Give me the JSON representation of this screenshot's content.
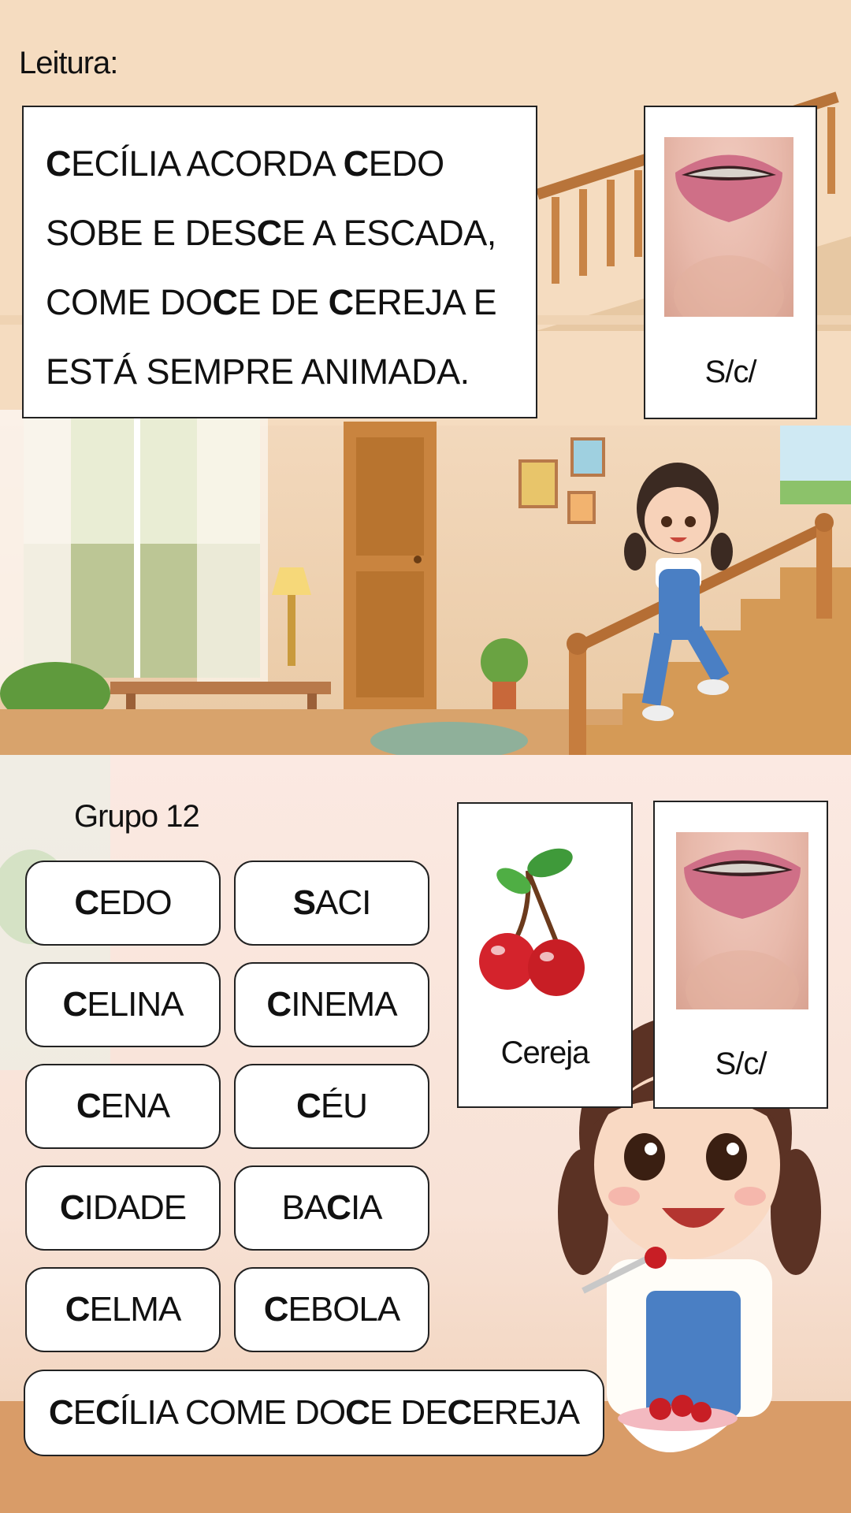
{
  "reading": {
    "label": "Leitura:",
    "lines": [
      [
        {
          "t": "C",
          "b": true
        },
        {
          "t": "ECÍLIA ACORDA "
        },
        {
          "t": "C",
          "b": true
        },
        {
          "t": "EDO"
        }
      ],
      [
        {
          "t": "SOBE E DES"
        },
        {
          "t": "C",
          "b": true
        },
        {
          "t": "E A ESCADA,"
        }
      ],
      [
        {
          "t": "COME DO"
        },
        {
          "t": "C",
          "b": true
        },
        {
          "t": "E DE "
        },
        {
          "t": "C",
          "b": true
        },
        {
          "t": "EREJA E"
        }
      ],
      [
        {
          "t": "ESTÁ SEMPRE ANIMADA."
        }
      ]
    ],
    "phoneme_label": "S/c/"
  },
  "group": {
    "label": "Grupo 12",
    "words": [
      {
        "bold": "C",
        "rest": "EDO",
        "pre": ""
      },
      {
        "bold": "S",
        "rest": "ACI",
        "pre": ""
      },
      {
        "bold": "C",
        "rest": "ELINA",
        "pre": ""
      },
      {
        "bold": "C",
        "rest": "INEMA",
        "pre": ""
      },
      {
        "bold": "C",
        "rest": "ENA",
        "pre": ""
      },
      {
        "bold": "C",
        "rest": "ÉU",
        "pre": ""
      },
      {
        "bold": "C",
        "rest": "IDADE",
        "pre": ""
      },
      {
        "pre": "BA",
        "bold": "C",
        "rest": "IA"
      },
      {
        "bold": "C",
        "rest": "ELMA",
        "pre": ""
      },
      {
        "bold": "C",
        "rest": "EBOLA",
        "pre": ""
      }
    ],
    "sentence": [
      {
        "t": "C",
        "b": true
      },
      {
        "t": "E"
      },
      {
        "t": "C",
        "b": true
      },
      {
        "t": "ÍLIA COME DO"
      },
      {
        "t": "C",
        "b": true
      },
      {
        "t": "E DE "
      },
      {
        "t": "C",
        "b": true
      },
      {
        "t": "EREJA"
      }
    ],
    "picture_label": "Cereja",
    "phoneme_label": "S/c/",
    "picture_icon": "cherry-icon"
  }
}
